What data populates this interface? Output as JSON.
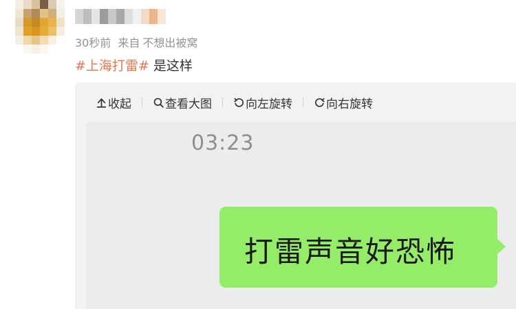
{
  "post": {
    "meta": {
      "time": "30秒前",
      "source_label": "来自",
      "client": "不想出被窝"
    },
    "hashtag": "#上海打雷#",
    "text": " 是这样"
  },
  "media": {
    "toolbar": {
      "collapse": "收起",
      "view_large": "查看大图",
      "rotate_left": "向左旋转",
      "rotate_right": "向右旋转"
    },
    "screenshot": {
      "time": "03:23",
      "message": "打雷声音好恐怖"
    }
  },
  "colors": {
    "hashtag": "#eb7350",
    "bubble": "#95ec69",
    "meta": "#939393"
  },
  "icons": [
    "collapse-icon",
    "magnifier-icon",
    "rotate-left-icon",
    "rotate-right-icon"
  ]
}
